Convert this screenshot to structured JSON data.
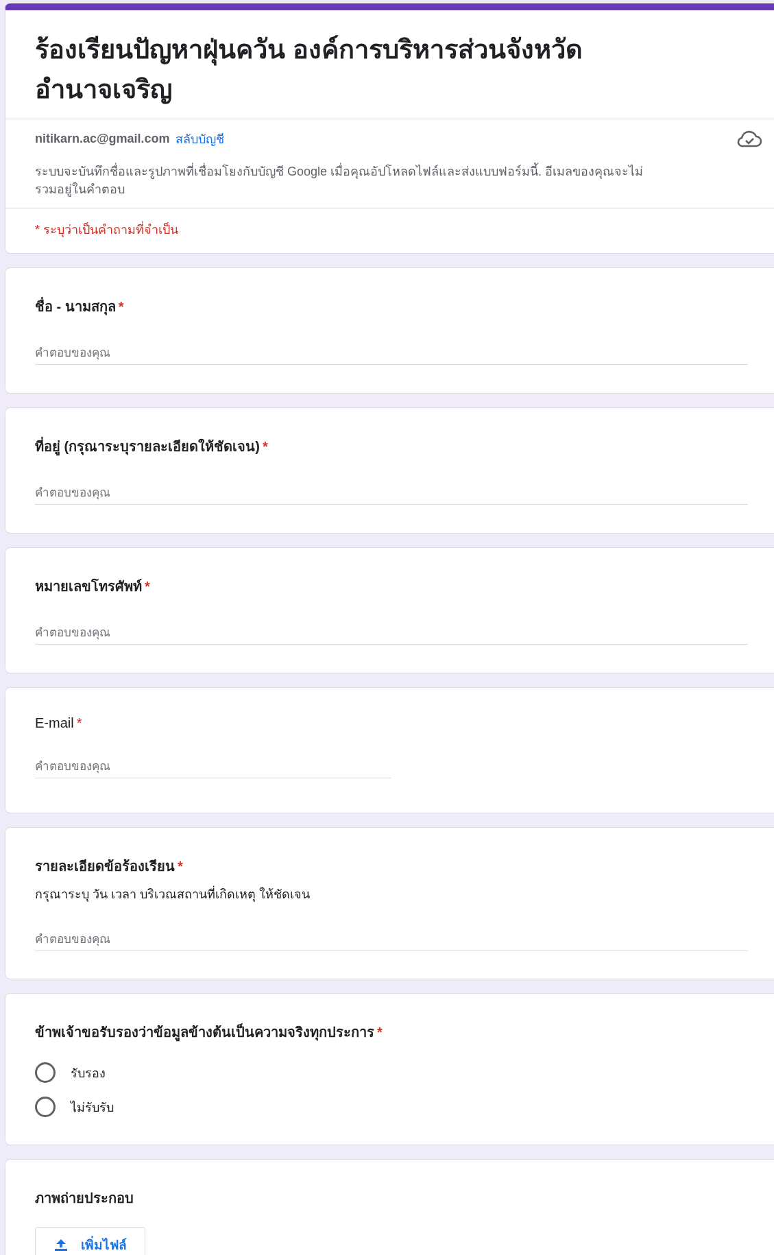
{
  "header": {
    "title": "ร้องเรียนปัญหาฝุ่นควัน องค์การบริหารส่วนจังหวัดอำนาจเจริญ",
    "account_email": "nitikarn.ac@gmail.com",
    "switch_account": "สลับบัญชี",
    "notice": "ระบบจะบันทึกชื่อและรูปภาพที่เชื่อมโยงกับบัญชี Google เมื่อคุณอัปโหลดไฟล์และส่งแบบฟอร์มนี้. อีเมลของคุณจะไม่รวมอยู่ในคำตอบ",
    "required_note": "* ระบุว่าเป็นคำถามที่จำเป็น"
  },
  "questions": [
    {
      "kind": "text",
      "title": "ชื่อ - นามสกุล",
      "required_mark": "*",
      "placeholder": "คำตอบของคุณ"
    },
    {
      "kind": "text",
      "title": "ที่อยู่ (กรุณาระบุรายละเอียดให้ชัดเจน)",
      "required_mark": "*",
      "placeholder": "คำตอบของคุณ"
    },
    {
      "kind": "text",
      "title": "หมายเลขโทรศัพท์",
      "required_mark": "*",
      "placeholder": "คำตอบของคุณ"
    },
    {
      "kind": "email",
      "title": "E-mail",
      "required_mark": "*",
      "placeholder": "คำตอบของคุณ"
    },
    {
      "kind": "text",
      "title": "รายละเอียดข้อร้องเรียน",
      "required_mark": "*",
      "description": "กรุณาระบุ วัน  เวลา  บริเวณสถานที่เกิดเหตุ ให้ชัดเจน",
      "placeholder": "คำตอบของคุณ"
    },
    {
      "kind": "radio",
      "title": "ข้าพเจ้าขอรับรองว่าข้อมูลข้างต้นเป็นความจริงทุกประการ",
      "required_mark": "*",
      "options": [
        {
          "label": "รับรอง",
          "selected": false
        },
        {
          "label": "ไม่รับรับ",
          "selected": false
        }
      ]
    },
    {
      "kind": "file",
      "title": "ภาพถ่ายประกอบ",
      "button": "เพิ่มไฟล์"
    }
  ]
}
